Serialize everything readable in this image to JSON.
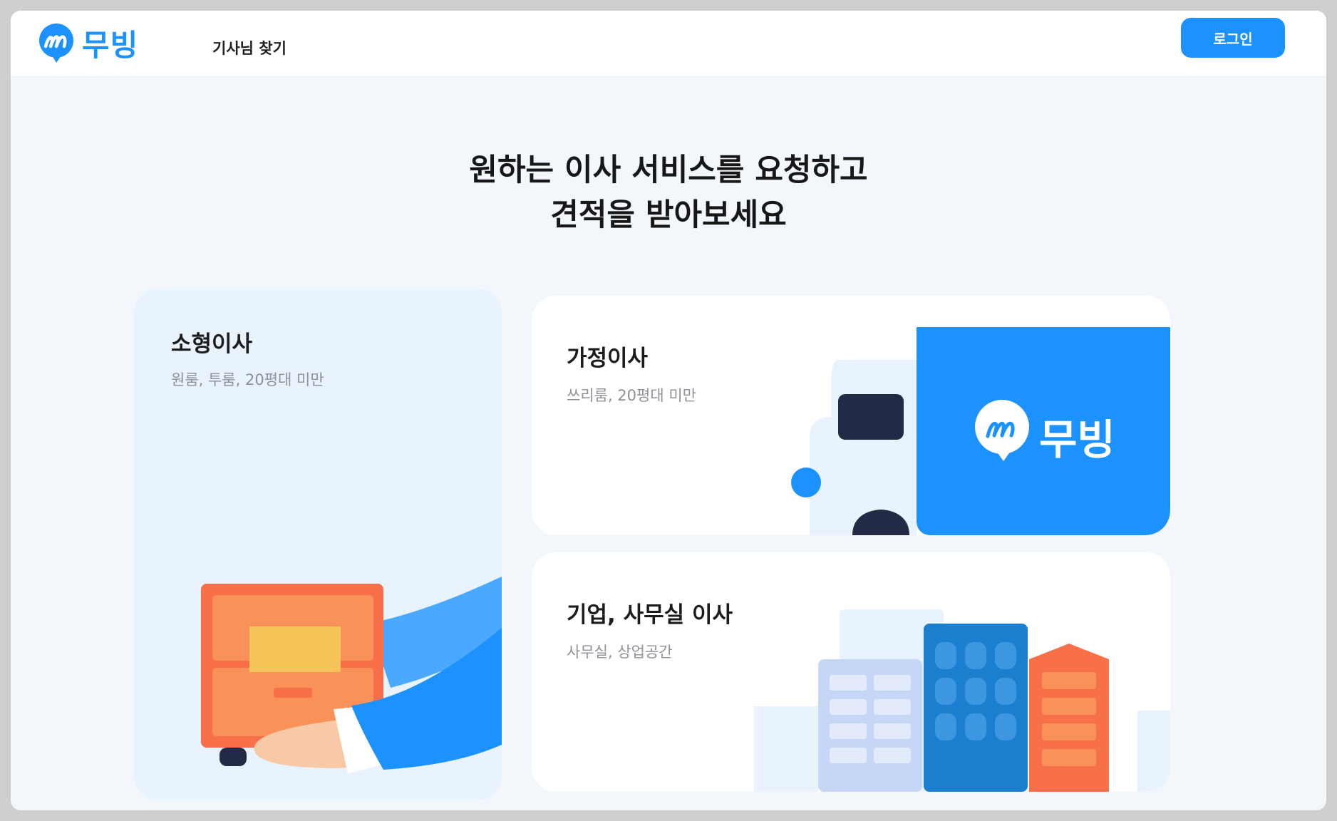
{
  "header": {
    "logo_text": "무빙",
    "nav_link": "기사님 찾기",
    "login_label": "로그인"
  },
  "hero": {
    "line1": "원하는 이사 서비스를 요청하고",
    "line2": "견적을 받아보세요"
  },
  "cards": [
    {
      "title": "소형이사",
      "subtitle": "원룸, 투룸, 20평대 미만"
    },
    {
      "title": "가정이사",
      "subtitle": "쓰리룸, 20평대 미만",
      "truck_logo_text": "무빙"
    },
    {
      "title": "기업, 사무실 이사",
      "subtitle": "사무실, 상업공간"
    }
  ],
  "colors": {
    "brand": "#1b92ff",
    "navy": "#232a45",
    "orange": "#f7704a",
    "light_card": "#e8f3fe"
  },
  "icons": [
    "moving-logo-icon",
    "truck-illustration",
    "box-hand-illustration",
    "buildings-illustration"
  ]
}
